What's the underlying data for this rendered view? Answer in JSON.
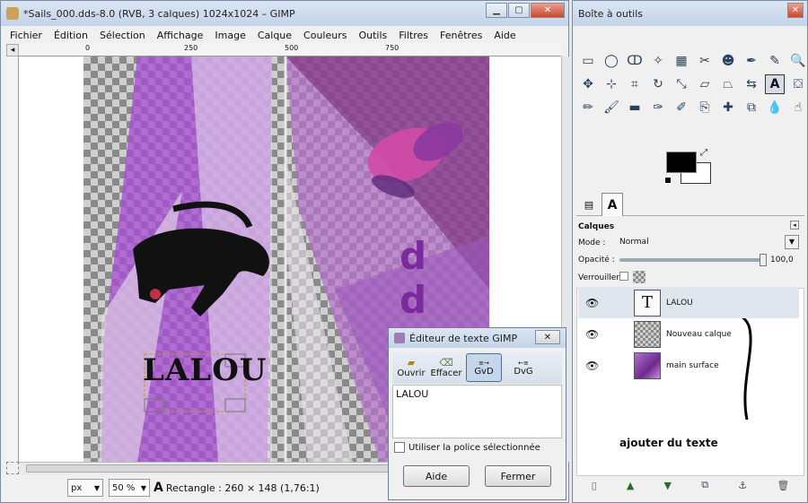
{
  "gimp_window": {
    "title": "*Sails_000.dds-8.0 (RVB, 3 calques) 1024x1024 – GIMP",
    "menu": [
      "Fichier",
      "Édition",
      "Sélection",
      "Affichage",
      "Image",
      "Calque",
      "Couleurs",
      "Outils",
      "Filtres",
      "Fenêtres",
      "Aide"
    ],
    "ruler_marks": [
      "0",
      "250",
      "500",
      "750"
    ],
    "canvas_text": {
      "lalou": "LALOU",
      "dd": "d d"
    },
    "status": {
      "unit": "px",
      "zoom": "50 %",
      "info": "Rectangle : 260 × 148  (1,76:1)"
    }
  },
  "toolbox": {
    "title": "Boîte à outils",
    "layers_panel": {
      "title": "Calques",
      "mode_label": "Mode :",
      "mode_value": "Normal",
      "opacity_label": "Opacité :",
      "opacity_value": "100,0",
      "opacity_fraction": 1.0,
      "lock_label": "Verrouiller :",
      "layers": [
        {
          "name": "LALOU",
          "kind": "text",
          "selected": true
        },
        {
          "name": "Nouveau calque",
          "kind": "transparent",
          "selected": false
        },
        {
          "name": "main surface",
          "kind": "image",
          "selected": false
        }
      ]
    },
    "annotation": "ajouter du texte"
  },
  "text_editor": {
    "title": "Éditeur de texte GIMP",
    "buttons": [
      "Ouvrir",
      "Effacer",
      "GvD",
      "DvG"
    ],
    "content": "LALOU",
    "checkbox_label": "Utiliser la police sélectionnée",
    "help_label": "Aide",
    "close_label": "Fermer"
  },
  "colors": {
    "accent": "#a64fd3",
    "titlebar": "#c3d3e7",
    "text_purple": "#7a2a9c"
  }
}
